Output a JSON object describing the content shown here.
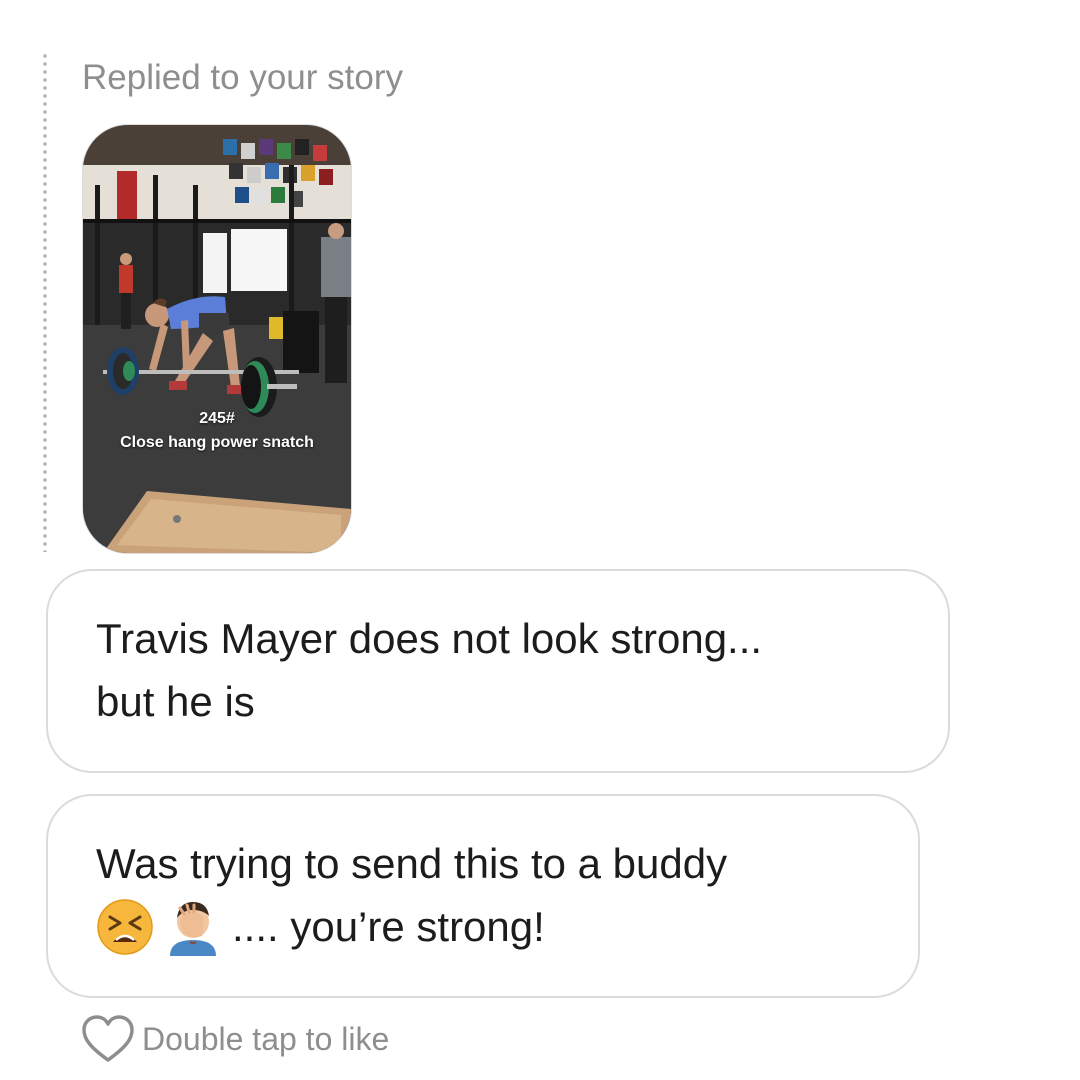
{
  "thread": {
    "reply_label": "Replied to your story",
    "story": {
      "weight_text": "245#",
      "lift_text": "Close hang power snatch"
    }
  },
  "messages": [
    {
      "lines": [
        "Travis Mayer does not look strong...",
        "but he is"
      ]
    },
    {
      "lines": [
        "Was trying to send this to a buddy"
      ],
      "emoji_line_text": ".... you’re strong!",
      "emojis": [
        "tired-face-emoji",
        "face-palm-emoji"
      ]
    }
  ],
  "like_hint": {
    "label": "Double tap to like",
    "icon": "heart-outline-icon"
  },
  "colors": {
    "muted_text": "#8e8e8e",
    "bubble_border": "#dbdbdb",
    "message_text": "#1c1c1c",
    "thread_dots": "#b8b8b8"
  }
}
